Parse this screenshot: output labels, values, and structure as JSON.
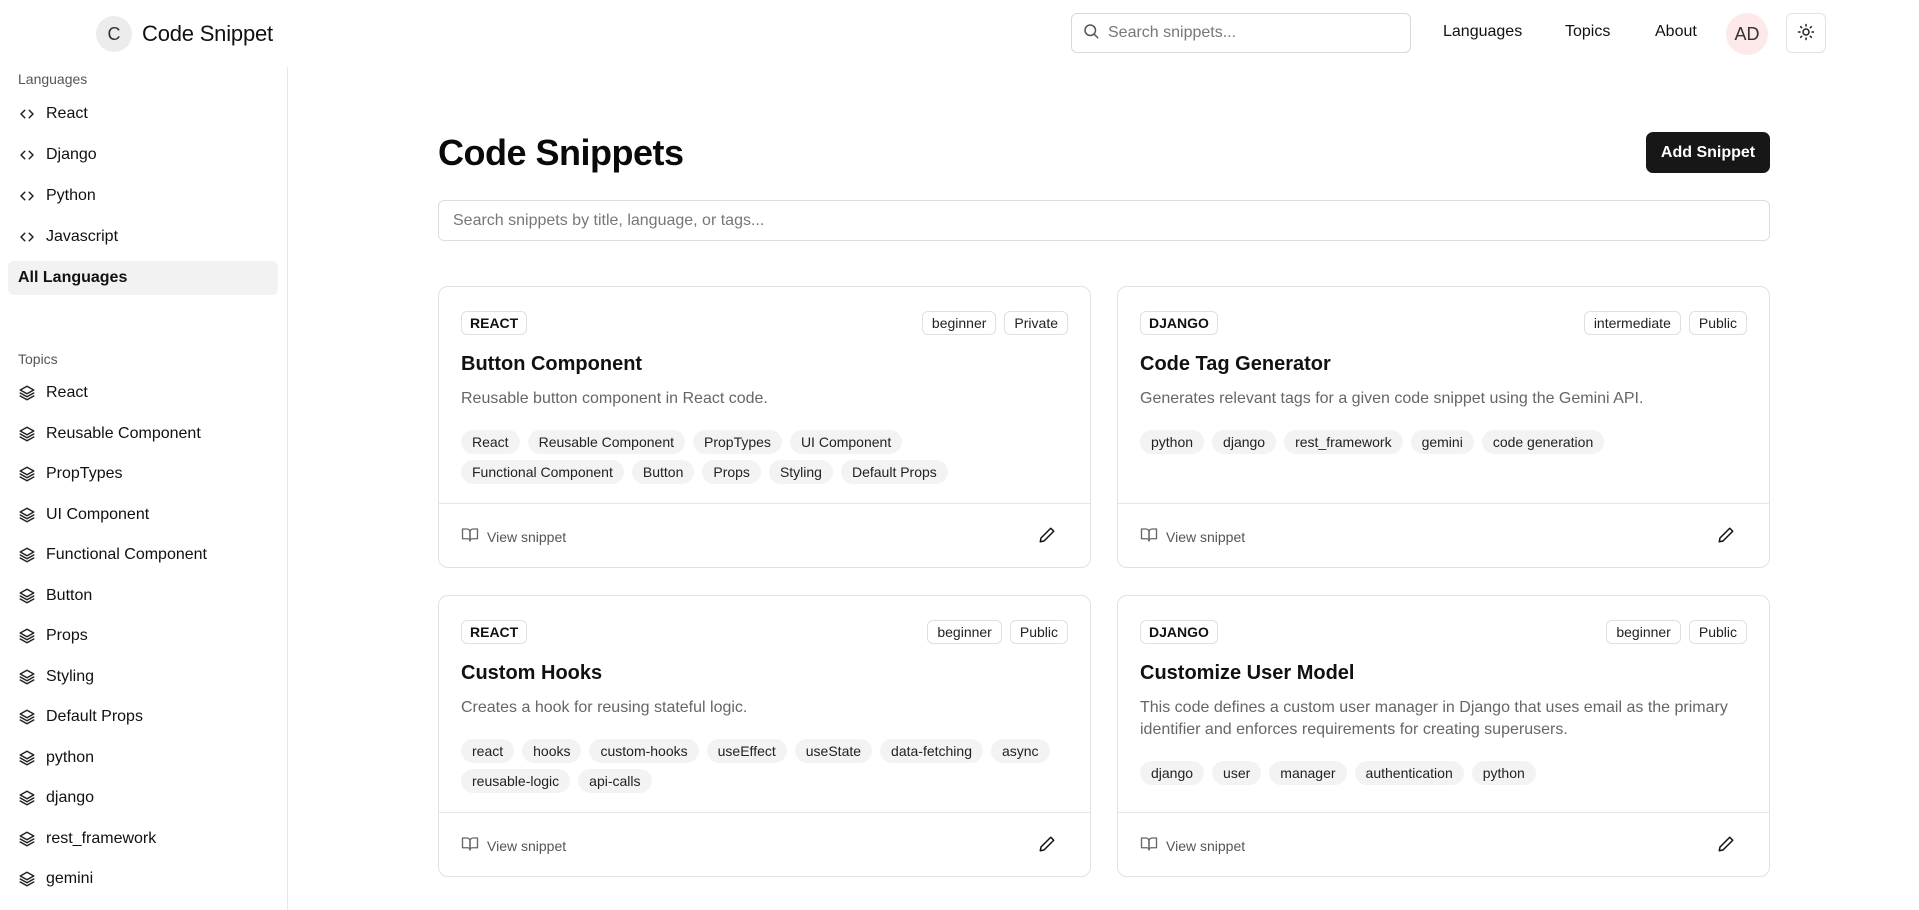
{
  "header": {
    "brand_initial": "C",
    "brand_name": "Code Snippet",
    "search_placeholder": "Search snippets...",
    "nav": [
      "Languages",
      "Topics",
      "About"
    ],
    "user_initials": "AD",
    "theme_icon": "sun-icon"
  },
  "sidebar": {
    "languages_heading": "Languages",
    "languages": [
      "React",
      "Django",
      "Python",
      "Javascript"
    ],
    "all_languages": "All Languages",
    "topics_heading": "Topics",
    "topics": [
      "React",
      "Reusable Component",
      "PropTypes",
      "UI Component",
      "Functional Component",
      "Button",
      "Props",
      "Styling",
      "Default Props",
      "python",
      "django",
      "rest_framework",
      "gemini"
    ]
  },
  "main": {
    "title": "Code Snippets",
    "add_button": "Add Snippet",
    "search_placeholder": "Search snippets by title, language, or tags...",
    "view_label": "View snippet",
    "cards": [
      {
        "language": "REACT",
        "level": "beginner",
        "visibility": "Private",
        "title": "Button Component",
        "description": "Reusable button component in React code.",
        "tags": [
          "React",
          "Reusable Component",
          "PropTypes",
          "UI Component",
          "Functional Component",
          "Button",
          "Props",
          "Styling",
          "Default Props"
        ]
      },
      {
        "language": "DJANGO",
        "level": "intermediate",
        "visibility": "Public",
        "title": "Code Tag Generator",
        "description": "Generates relevant tags for a given code snippet using the Gemini API.",
        "tags": [
          "python",
          "django",
          "rest_framework",
          "gemini",
          "code generation"
        ]
      },
      {
        "language": "REACT",
        "level": "beginner",
        "visibility": "Public",
        "title": "Custom Hooks",
        "description": "Creates a hook for reusing stateful logic.",
        "tags": [
          "react",
          "hooks",
          "custom-hooks",
          "useEffect",
          "useState",
          "data-fetching",
          "async",
          "reusable-logic",
          "api-calls"
        ]
      },
      {
        "language": "DJANGO",
        "level": "beginner",
        "visibility": "Public",
        "title": "Customize User Model",
        "description": "This code defines a custom user manager in Django that uses email as the primary identifier and enforces requirements for creating superusers.",
        "tags": [
          "django",
          "user",
          "manager",
          "authentication",
          "python"
        ]
      }
    ]
  }
}
